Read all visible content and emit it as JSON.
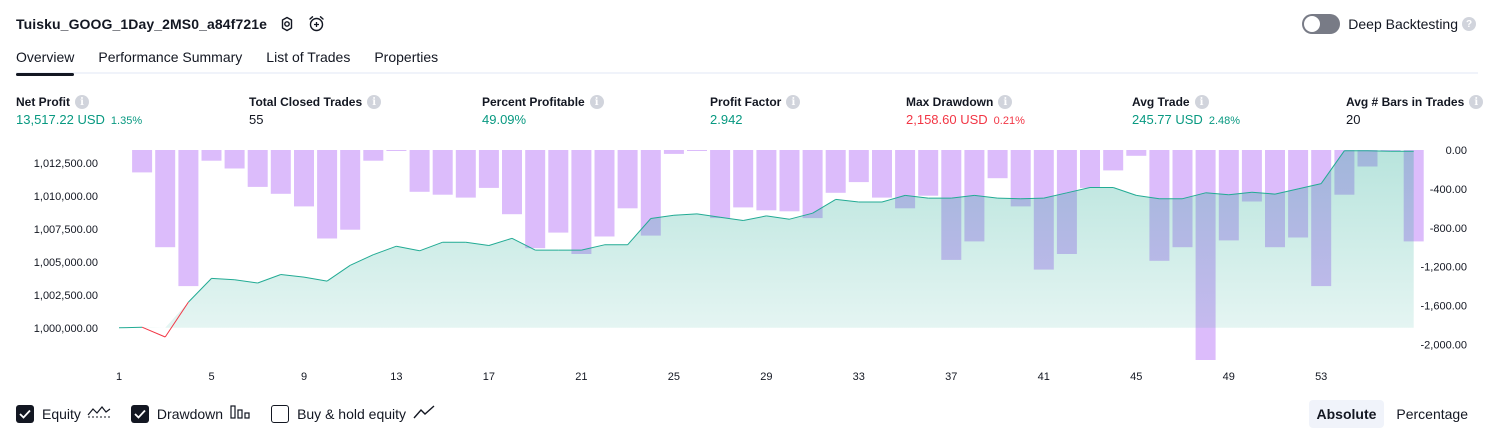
{
  "header": {
    "title": "Tuisku_GOOG_1Day_2MS0_a84f721e",
    "settings_icon": "gear-icon",
    "add_alert_icon": "alarm-plus-icon",
    "deep_backtesting_label": "Deep Backtesting",
    "deep_backtesting_enabled": false,
    "help_icon": "question-icon",
    "help_glyph": "?"
  },
  "tabs": [
    {
      "label": "Overview",
      "active": true
    },
    {
      "label": "Performance Summary",
      "active": false
    },
    {
      "label": "List of Trades",
      "active": false
    },
    {
      "label": "Properties",
      "active": false
    }
  ],
  "metrics": {
    "info_glyph": "i",
    "net_profit": {
      "label": "Net Profit",
      "value": "13,517.22 USD",
      "sub": "1.35%"
    },
    "total_closed_trades": {
      "label": "Total Closed Trades",
      "value": "55"
    },
    "percent_profitable": {
      "label": "Percent Profitable",
      "value": "49.09%"
    },
    "profit_factor": {
      "label": "Profit Factor",
      "value": "2.942"
    },
    "max_drawdown": {
      "label": "Max Drawdown",
      "value": "2,158.60 USD",
      "sub": "0.21%"
    },
    "avg_trade": {
      "label": "Avg Trade",
      "value": "245.77 USD",
      "sub": "2.48%"
    },
    "avg_bars": {
      "label": "Avg # Bars in Trades",
      "value": "20"
    }
  },
  "colors": {
    "equity_line": "#22ab94",
    "equity_fill": "#22ab94",
    "equity_negative": "#f23645",
    "drawdown_bar": "#dcbcfb",
    "positive": "#089981",
    "negative": "#f23645"
  },
  "chart_data": {
    "type": "line",
    "x_ticks": [
      "1",
      "5",
      "9",
      "13",
      "17",
      "21",
      "25",
      "29",
      "33",
      "37",
      "41",
      "45",
      "49",
      "53"
    ],
    "left_axis_ticks": [
      "1,012,500.00",
      "1,010,000.00",
      "1,007,500.00",
      "1,005,000.00",
      "1,002,500.00",
      "1,000,000.00"
    ],
    "right_axis_ticks": [
      "0.00",
      "-400.00",
      "-800.00",
      "-1,200.00",
      "-1,600.00",
      "-2,000.00"
    ],
    "left_ylim": [
      999000,
      1013500
    ],
    "right_ylim": [
      -2160,
      0
    ],
    "grid": false,
    "series": [
      {
        "name": "Equity",
        "axis": "left",
        "x": [
          1,
          2,
          3,
          4,
          5,
          6,
          7,
          8,
          9,
          10,
          11,
          12,
          13,
          14,
          15,
          16,
          17,
          18,
          19,
          20,
          21,
          22,
          23,
          24,
          25,
          26,
          27,
          28,
          29,
          30,
          31,
          32,
          33,
          34,
          35,
          36,
          37,
          38,
          39,
          40,
          41,
          42,
          43,
          44,
          45,
          46,
          47,
          48,
          49,
          50,
          51,
          52,
          53,
          54,
          55,
          56,
          57
        ],
        "values": [
          1000000,
          1000050,
          999300,
          1001950,
          1003750,
          1003650,
          1003400,
          1004050,
          1003850,
          1003550,
          1004750,
          1005550,
          1006200,
          1005850,
          1006500,
          1006500,
          1006250,
          1006800,
          1005900,
          1005900,
          1005900,
          1006300,
          1006300,
          1008300,
          1008550,
          1008650,
          1008400,
          1008150,
          1008500,
          1008250,
          1008700,
          1009750,
          1009550,
          1009550,
          1010050,
          1009850,
          1009850,
          1010050,
          1009850,
          1009800,
          1009850,
          1010250,
          1010650,
          1010650,
          1010050,
          1009800,
          1009800,
          1010250,
          1010100,
          1010300,
          1010150,
          1010550,
          1010950,
          1013450,
          1013450,
          1013400,
          1013400
        ]
      },
      {
        "name": "Drawdown",
        "axis": "right",
        "x": [
          2,
          3,
          4,
          5,
          6,
          7,
          8,
          9,
          10,
          11,
          12,
          13,
          14,
          15,
          16,
          17,
          18,
          19,
          20,
          21,
          22,
          23,
          24,
          25,
          26,
          27,
          28,
          29,
          30,
          31,
          32,
          33,
          34,
          35,
          36,
          37,
          38,
          39,
          40,
          41,
          42,
          43,
          44,
          45,
          46,
          47,
          48,
          49,
          50,
          51,
          52,
          53,
          54,
          55,
          56,
          57
        ],
        "values": [
          -230,
          -1000,
          -1400,
          -110,
          -190,
          -380,
          -450,
          -580,
          -910,
          -820,
          -110,
          -5,
          -430,
          -460,
          -490,
          -390,
          -660,
          -1010,
          -850,
          -1070,
          -890,
          -600,
          -880,
          -40,
          -5,
          -700,
          -590,
          -620,
          -630,
          -700,
          -440,
          -330,
          -490,
          -600,
          -470,
          -1130,
          -940,
          -290,
          -580,
          -1230,
          -1070,
          -390,
          -210,
          -60,
          -1140,
          -1000,
          -2160,
          -930,
          -530,
          -1000,
          -900,
          -1400,
          -460,
          -170,
          -5,
          -940
        ]
      }
    ]
  },
  "legend": {
    "equity": {
      "label": "Equity",
      "checked": true,
      "icon": "equity-line-icon"
    },
    "drawdown": {
      "label": "Drawdown",
      "checked": true,
      "icon": "bar-chart-icon"
    },
    "buy_hold": {
      "label": "Buy & hold equity",
      "checked": false,
      "icon": "trend-line-icon"
    }
  },
  "mode": {
    "absolute": "Absolute",
    "percentage": "Percentage",
    "selected": "Absolute"
  }
}
